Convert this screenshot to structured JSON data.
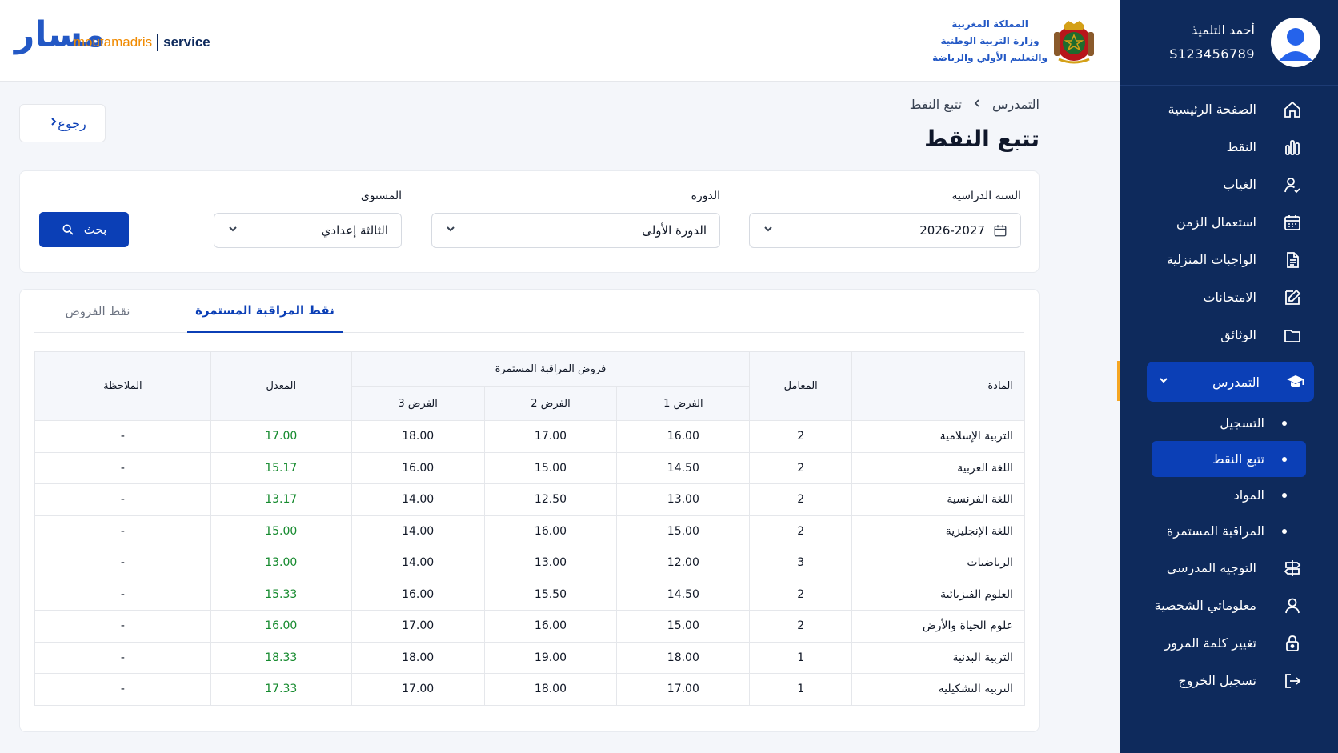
{
  "header": {
    "logo_arabic": "مسار",
    "logo_main": "moutamadris",
    "logo_service": "service",
    "ministry_lines": [
      "المملكة المغربية",
      "وزارة التربية الوطنية",
      "والتعليم الأولي والرياضة"
    ]
  },
  "user": {
    "name": "أحمد التلميذ",
    "id": "S123456789"
  },
  "sidebar": {
    "items": [
      {
        "label": "الصفحة الرئيسية",
        "icon": "home-icon"
      },
      {
        "label": "النقط",
        "icon": "bar-chart-icon"
      },
      {
        "label": "الغياب",
        "icon": "user-check-icon"
      },
      {
        "label": "استعمال الزمن",
        "icon": "calendar-icon"
      },
      {
        "label": "الواجبات المنزلية",
        "icon": "document-icon"
      },
      {
        "label": "الامتحانات",
        "icon": "edit-icon"
      },
      {
        "label": "الوثائق",
        "icon": "folder-icon"
      }
    ],
    "active_item": {
      "label": "التمدرس",
      "icon": "graduation-cap-icon"
    },
    "sub_items": [
      "التسجيل",
      "تتبع النقط",
      "المواد",
      "المراقبة المستمرة"
    ],
    "active_sub_index": 1,
    "bottom_items": [
      {
        "label": "التوجيه المدرسي",
        "icon": "signpost-icon"
      },
      {
        "label": "معلوماتي الشخصية",
        "icon": "user-icon"
      },
      {
        "label": "تغيير كلمة المرور",
        "icon": "lock-icon"
      },
      {
        "label": "تسجيل الخروج",
        "icon": "logout-icon"
      }
    ],
    "accent_color": "#f5a623",
    "background": "#0e2a5c"
  },
  "page": {
    "breadcrumb": [
      "التمدرس",
      "تتبع النقط"
    ],
    "title": "تتبع النقط",
    "back_label": "رجوع"
  },
  "filters": {
    "year_label": "السنة الدراسية",
    "year_value": "2026-2027",
    "term_label": "الدورة",
    "term_value": "الدورة الأولى",
    "level_label": "المستوى",
    "level_value": "الثالثة إعدادي",
    "search_label": "بحث"
  },
  "tabs": {
    "continuous": "نقط المراقبة المستمرة",
    "exams": "نقط الفروض"
  },
  "table": {
    "headers": {
      "subject": "المادة",
      "coefficient": "المعامل",
      "group": "فروض المراقبة المستمرة",
      "test1": "الفرض 1",
      "test2": "الفرض 2",
      "test3": "الفرض 3",
      "average": "المعدل",
      "note": "الملاحظة"
    },
    "rows": [
      {
        "subject": "التربية الإسلامية",
        "coef": "2",
        "t1": "16.00",
        "t2": "17.00",
        "t3": "18.00",
        "avg": "17.00",
        "note": "-"
      },
      {
        "subject": "اللغة العربية",
        "coef": "2",
        "t1": "14.50",
        "t2": "15.00",
        "t3": "16.00",
        "avg": "15.17",
        "note": "-"
      },
      {
        "subject": "اللغة الفرنسية",
        "coef": "2",
        "t1": "13.00",
        "t2": "12.50",
        "t3": "14.00",
        "avg": "13.17",
        "note": "-"
      },
      {
        "subject": "اللغة الإنجليزية",
        "coef": "2",
        "t1": "15.00",
        "t2": "16.00",
        "t3": "14.00",
        "avg": "15.00",
        "note": "-"
      },
      {
        "subject": "الرياضيات",
        "coef": "3",
        "t1": "12.00",
        "t2": "13.00",
        "t3": "14.00",
        "avg": "13.00",
        "note": "-"
      },
      {
        "subject": "العلوم الفيزيائية",
        "coef": "2",
        "t1": "14.50",
        "t2": "15.50",
        "t3": "16.00",
        "avg": "15.33",
        "note": "-"
      },
      {
        "subject": "علوم الحياة والأرض",
        "coef": "2",
        "t1": "15.00",
        "t2": "16.00",
        "t3": "17.00",
        "avg": "16.00",
        "note": "-"
      },
      {
        "subject": "التربية البدنية",
        "coef": "1",
        "t1": "18.00",
        "t2": "19.00",
        "t3": "18.00",
        "avg": "18.33",
        "note": "-"
      },
      {
        "subject": "التربية التشكيلية",
        "coef": "1",
        "t1": "17.00",
        "t2": "18.00",
        "t3": "17.00",
        "avg": "17.33",
        "note": "-"
      }
    ],
    "average_color": "#158a2e"
  }
}
